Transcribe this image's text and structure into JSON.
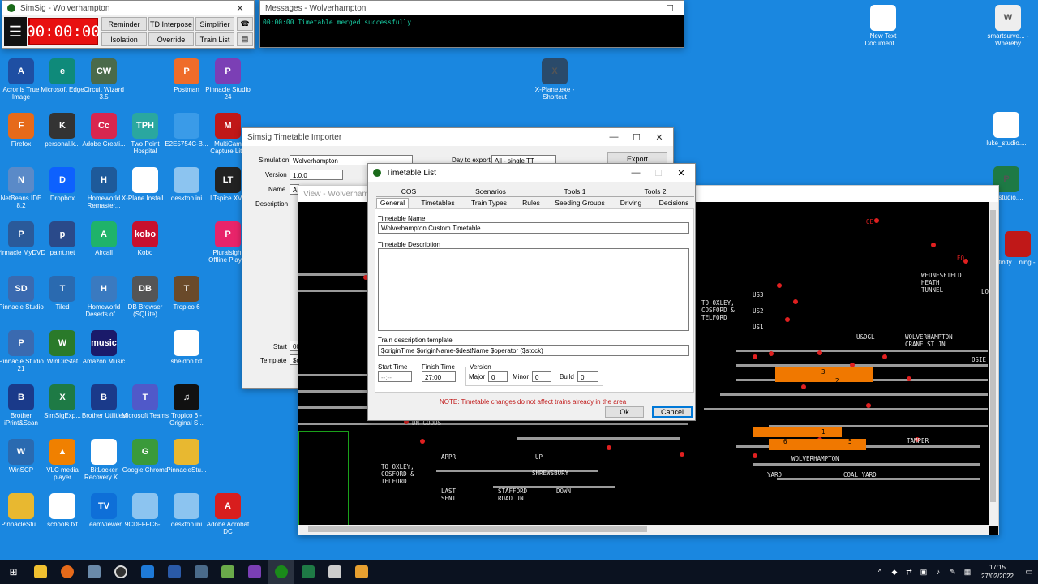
{
  "simsig": {
    "title": "SimSig - Wolverhampton",
    "clock": "00:00:00",
    "buttons": [
      "Reminder",
      "TD Interpose",
      "Simplifier",
      "Isolation",
      "Override",
      "Train List"
    ]
  },
  "messages": {
    "title": "Messages - Wolverhampton",
    "line": "00:00:00 Timetable merged successfully"
  },
  "importer": {
    "title": "Simsig Timetable Importer",
    "simulation_label": "Simulation",
    "simulation_value": "Wolverhampton",
    "version_label": "Version",
    "version_value": "1.0.0",
    "name_label": "Name",
    "name_value": "A",
    "description_label": "Description",
    "start_label": "Start",
    "start_value": "00",
    "template_label": "Template",
    "template_value": "$o",
    "day_label": "Day to export",
    "day_value": "All - single TT",
    "export_label": "Export",
    "view_label": "View - Wolverhampton"
  },
  "dialog": {
    "title": "Timetable List",
    "tabs_row1": [
      "COS",
      "Scenarios",
      "Tools 1",
      "Tools 2"
    ],
    "tabs_row2": [
      "General",
      "Timetables",
      "Train Types",
      "Rules",
      "Seeding Groups",
      "Driving",
      "Decisions"
    ],
    "name_label": "Timetable Name",
    "name_value": "Wolverhampton Custom Timetable",
    "desc_label": "Timetable Description",
    "template_label": "Train description template",
    "template_value": "$originTime $originName-$destName $operator ($stock)",
    "start_label": "Start Time",
    "start_value": "--:--",
    "finish_label": "Finish Time",
    "finish_value": "27:00",
    "version_label": "Version",
    "major_label": "Major",
    "major_value": "0",
    "minor_label": "Minor",
    "minor_value": "0",
    "build_label": "Build",
    "build_value": "0",
    "note": "NOTE: Timetable changes do not affect trains already in the area",
    "ok_label": "Ok",
    "cancel_label": "Cancel"
  },
  "map": {
    "labels": {
      "oxley_top": "TO OXLEY,\nCOSFORD &\nTELFORD",
      "wednesfield": "WEDNESFIELD\nHEATH\nTUNNEL",
      "crane": "WOLVERHAMPTON\nCRANE ST JN",
      "udgl": "U&DGL",
      "us3": "US3",
      "us2": "US2",
      "us1": "US1",
      "tamper": "TAMPER",
      "wolverhampton": "WOLVERHAMPTON",
      "yard": "YARD",
      "coal_yard": "COAL YARD",
      "dn_goods": "DN GOODS",
      "oxley_bot": "TO OXLEY,\nCOSFORD &\nTELFORD",
      "appr": "APPR",
      "last_sent": "LAST\nSENT",
      "up": "UP",
      "shrewsbury": "SHREWSBURY",
      "stafford": "STAFFORD\nROAD JN",
      "down": "DOWN",
      "oe": "OE",
      "eo": "EO",
      "osie": "OSIE",
      "lo": "LO"
    },
    "platforms": [
      "3",
      "2",
      "1",
      "6",
      "5"
    ]
  },
  "desktop_icons": [
    {
      "label": "Acronis True Image",
      "color": "#1e4fa3",
      "g": "A"
    },
    {
      "label": "Microsoft Edge",
      "color": "#0f8a7a",
      "g": "e"
    },
    {
      "label": "Circuit Wizard 3.5",
      "color": "#4a6a4a",
      "g": "CW"
    },
    {
      "label": "",
      "color": "",
      "g": ""
    },
    {
      "label": "Postman",
      "color": "#ef6c2a",
      "g": "P"
    },
    {
      "label": "Pinnacle Studio 24",
      "color": "#7b3fb5",
      "g": "P"
    },
    {
      "label": "Firefox",
      "color": "#e66a1a",
      "g": "F"
    },
    {
      "label": "personal.k...",
      "color": "#333",
      "g": "K"
    },
    {
      "label": "Adobe Creati...",
      "color": "#d8264f",
      "g": "Cc"
    },
    {
      "label": "Two Point Hospital",
      "color": "#2aa7a0",
      "g": "TPH"
    },
    {
      "label": "E2E5754C-B...",
      "color": "#3a9be8",
      "g": ""
    },
    {
      "label": "MultiCam Capture Lite",
      "color": "#c01818",
      "g": "M"
    },
    {
      "label": "NetBeans IDE 8.2",
      "color": "#5a8ac8",
      "g": "N"
    },
    {
      "label": "Dropbox",
      "color": "#0d61fe",
      "g": "D"
    },
    {
      "label": "Homeworld Remaster...",
      "color": "#1e5a9a",
      "g": "H"
    },
    {
      "label": "X-Plane Install...",
      "color": "#fff",
      "g": ""
    },
    {
      "label": "desktop.ini",
      "color": "#8cc4f0",
      "g": ""
    },
    {
      "label": "LTspice XVII",
      "color": "#222",
      "g": "LT"
    },
    {
      "label": "Pinnacle MyDVD",
      "color": "#2a5a9a",
      "g": "P"
    },
    {
      "label": "paint.net",
      "color": "#2a4a8a",
      "g": "p"
    },
    {
      "label": "Aircall",
      "color": "#1fb36a",
      "g": "A"
    },
    {
      "label": "Kobo",
      "color": "#c8102e",
      "g": "kobo"
    },
    {
      "label": "",
      "color": "",
      "g": ""
    },
    {
      "label": "Pluralsight Offline Player",
      "color": "#e8246a",
      "g": "P"
    },
    {
      "label": "Pinnacle Studio ...",
      "color": "#3a6ab0",
      "g": "SD"
    },
    {
      "label": "Tiled",
      "color": "#2a6ab0",
      "g": "T"
    },
    {
      "label": "Homeworld Deserts of ...",
      "color": "#3a7ac0",
      "g": "H"
    },
    {
      "label": "DB Browser (SQLite)",
      "color": "#555",
      "g": "DB"
    },
    {
      "label": "Tropico 6",
      "color": "#6a4a2a",
      "g": "T"
    },
    {
      "label": "",
      "color": "",
      "g": ""
    },
    {
      "label": "Pinnacle Studio 21",
      "color": "#3a6ab0",
      "g": "P"
    },
    {
      "label": "WinDirStat",
      "color": "#2a7a2a",
      "g": "W"
    },
    {
      "label": "Amazon Music",
      "color": "#1a1a6a",
      "g": "music"
    },
    {
      "label": "",
      "color": "",
      "g": ""
    },
    {
      "label": "sheldon.txt",
      "color": "#fff",
      "g": ""
    },
    {
      "label": "",
      "color": "",
      "g": ""
    },
    {
      "label": "Brother iPrint&Scan",
      "color": "#1a3a8a",
      "g": "B"
    },
    {
      "label": "SimSigExp...",
      "color": "#1e7a45",
      "g": "X"
    },
    {
      "label": "Brother Utilities",
      "color": "#1a3a8a",
      "g": "B"
    },
    {
      "label": "Microsoft Teams",
      "color": "#5059c9",
      "g": "T"
    },
    {
      "label": "Tropico 6 - Original S...",
      "color": "#111",
      "g": "♫"
    },
    {
      "label": "",
      "color": "",
      "g": ""
    },
    {
      "label": "WinSCP",
      "color": "#2a6ab0",
      "g": "W"
    },
    {
      "label": "VLC media player",
      "color": "#f08000",
      "g": "▲"
    },
    {
      "label": "BitLocker Recovery K...",
      "color": "#fff",
      "g": ""
    },
    {
      "label": "Google Chrome",
      "color": "#3a9a3a",
      "g": "G"
    },
    {
      "label": "PinnacleStu...",
      "color": "#e8b830",
      "g": ""
    },
    {
      "label": "",
      "color": "",
      "g": ""
    },
    {
      "label": "PinnacleStu...",
      "color": "#e8b830",
      "g": ""
    },
    {
      "label": "schools.txt",
      "color": "#fff",
      "g": ""
    },
    {
      "label": "TeamViewer",
      "color": "#0e6fd8",
      "g": "TV"
    },
    {
      "label": "9CDFFFC6-...",
      "color": "#8cc4f0",
      "g": ""
    },
    {
      "label": "desktop.ini",
      "color": "#8cc4f0",
      "g": ""
    },
    {
      "label": "Adobe Acrobat DC",
      "color": "#d81e1e",
      "g": "A"
    }
  ],
  "right_icons": [
    {
      "label": "New Text Document....",
      "color": "#fff",
      "g": ""
    },
    {
      "label": "smartsurve... - Whereby",
      "color": "#eee",
      "g": "W"
    },
    {
      "label": "X-Plane.exe - Shortcut",
      "color": "#2a4a6a",
      "g": "X"
    },
    {
      "label": "luke_studio....",
      "color": "#fff",
      "g": ""
    },
    {
      "label": "..._studio....",
      "color": "#1e7a45",
      "g": "P"
    },
    {
      "label": "Infinity ...ning - ...",
      "color": "#c01818",
      "g": ""
    }
  ],
  "taskbar": {
    "time": "17:15",
    "date": "27/02/2022"
  }
}
